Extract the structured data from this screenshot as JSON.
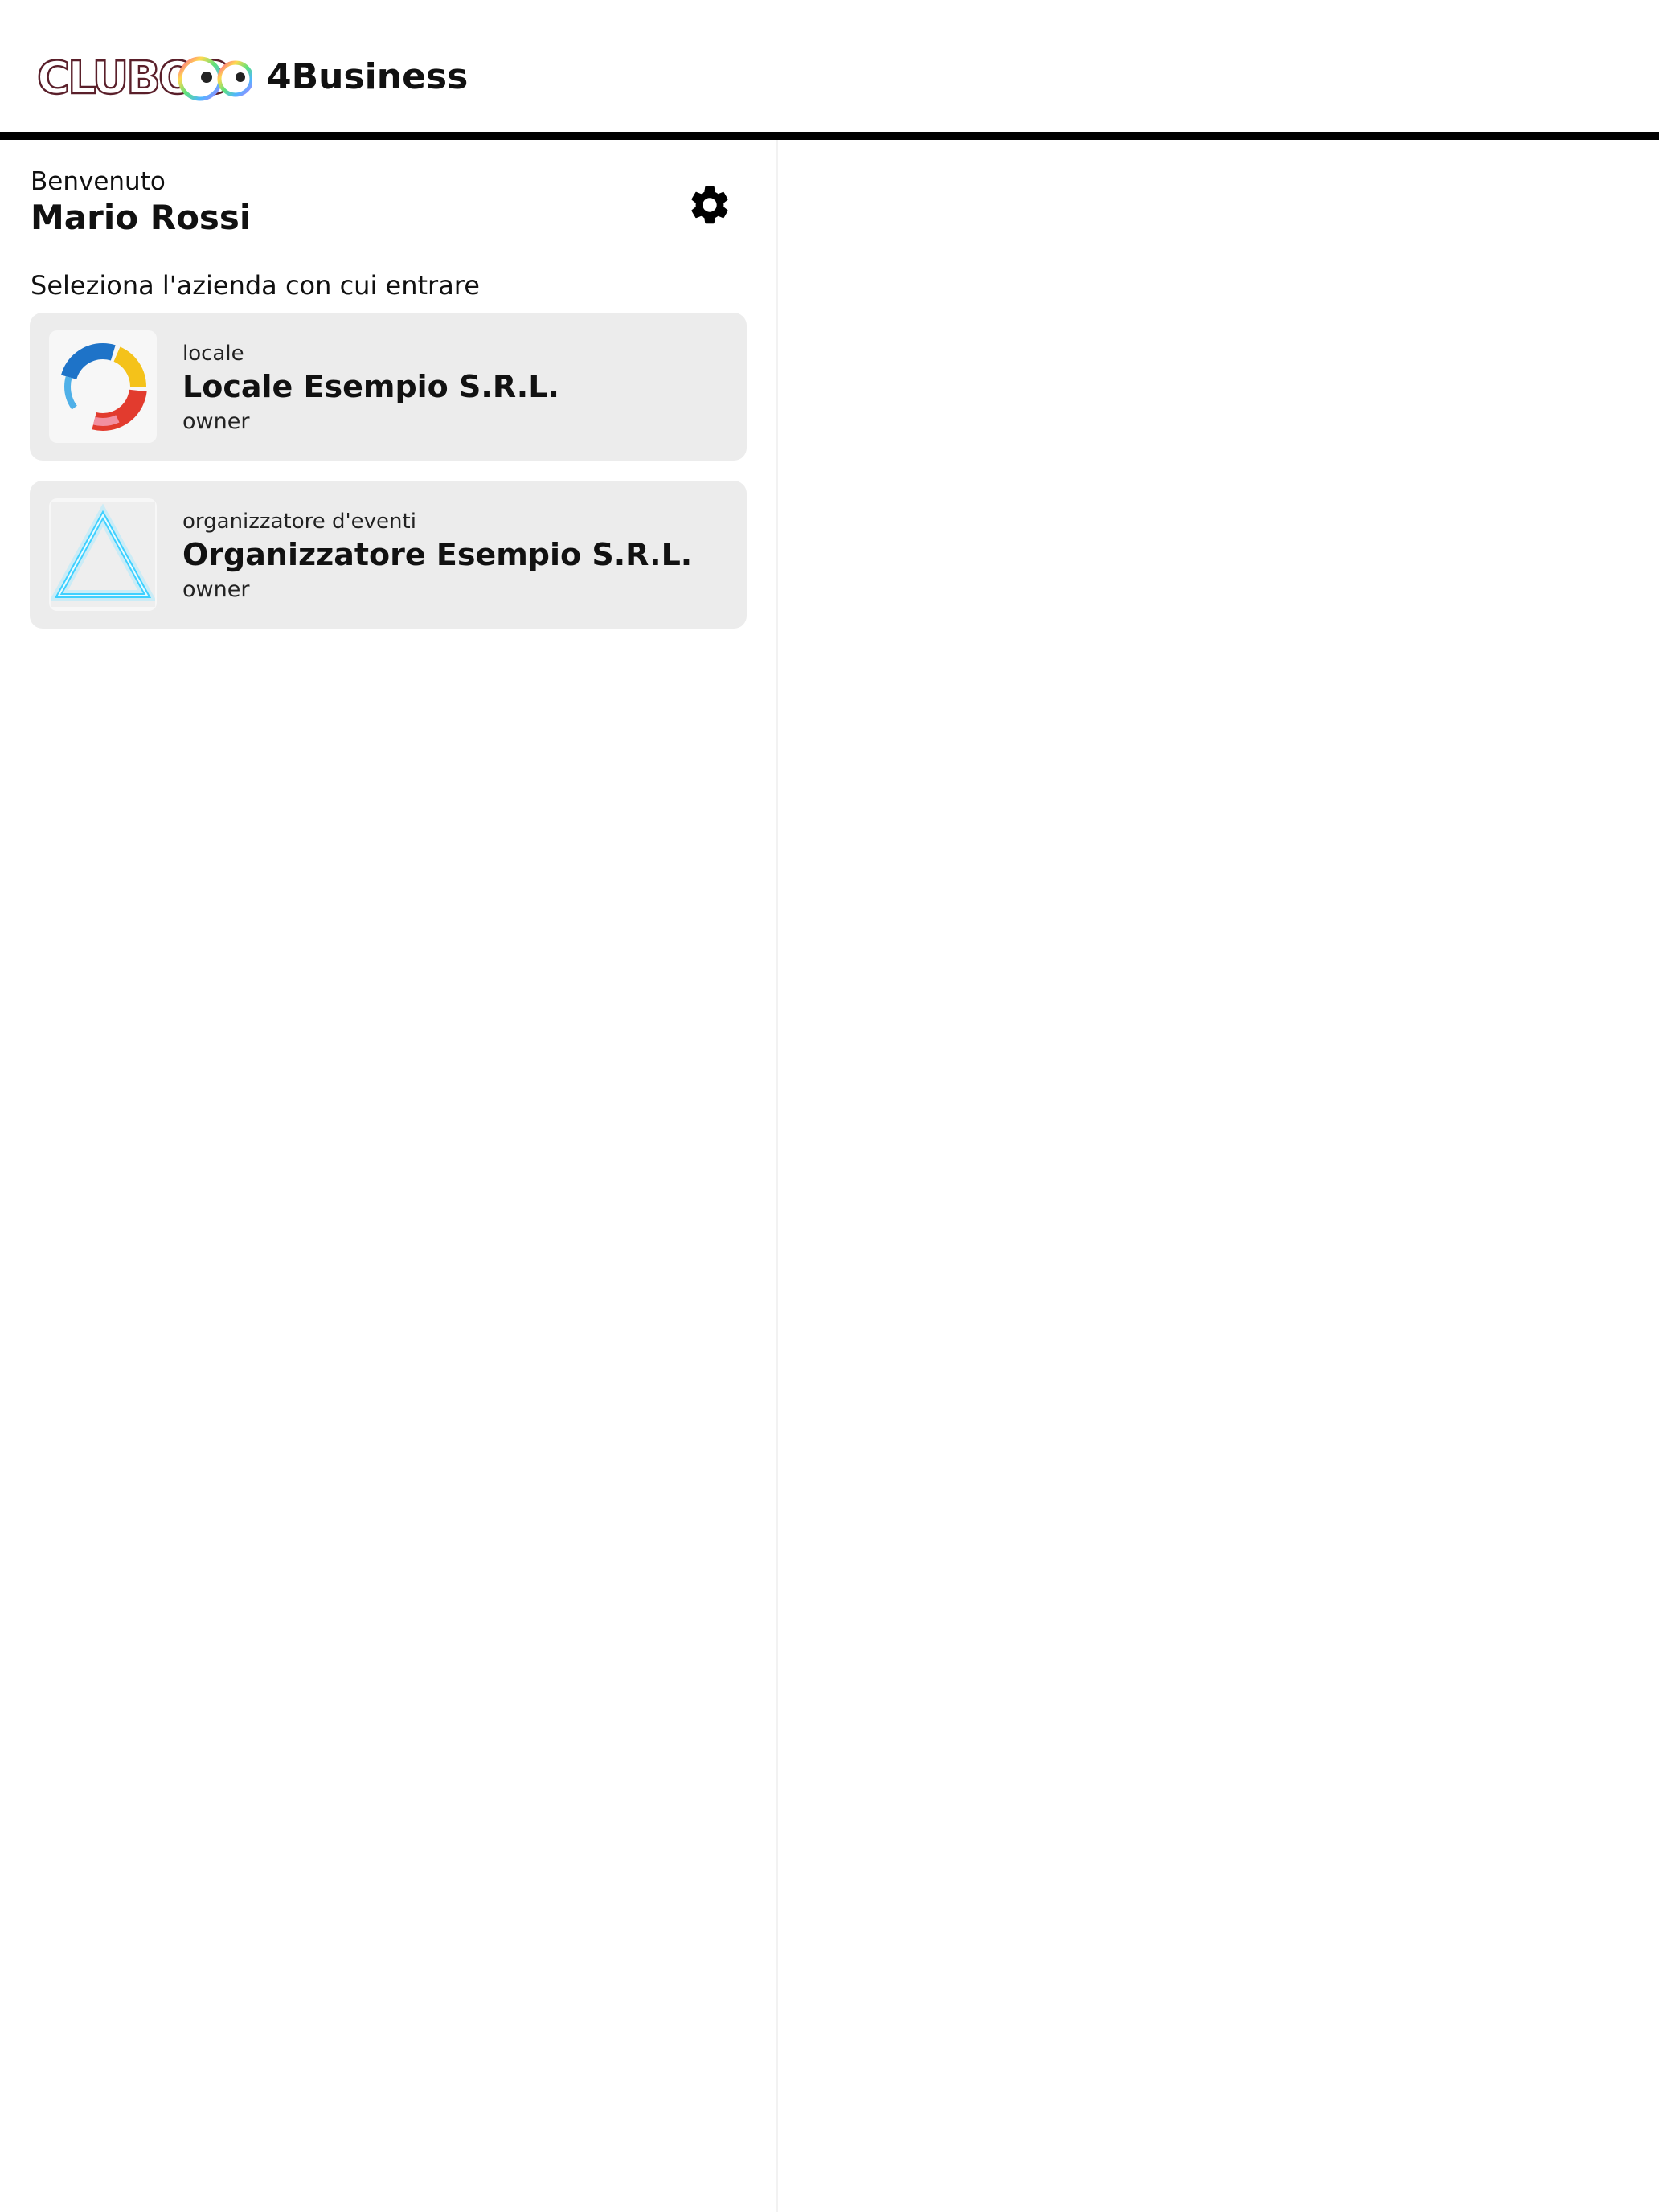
{
  "header": {
    "logo_text": "CLUBOO",
    "brand_suffix": "4Business"
  },
  "welcome": {
    "label": "Benvenuto",
    "user_name": "Mario Rossi"
  },
  "settings": {
    "icon": "gear-icon"
  },
  "company_select": {
    "prompt": "Seleziona l'azienda con cui entrare",
    "companies": [
      {
        "type": "locale",
        "name": "Locale Esempio S.R.L.",
        "role": "owner",
        "logo_icon": "colorful-ring-logo"
      },
      {
        "type": "organizzatore d'eventi",
        "name": "Organizzatore Esempio S.R.L.",
        "role": "owner",
        "logo_icon": "neon-triangle-logo"
      }
    ]
  },
  "colors": {
    "header_rule": "#000000",
    "card_background": "#ececec",
    "text": "#111111",
    "neon_triangle": "#3fd0ff"
  }
}
